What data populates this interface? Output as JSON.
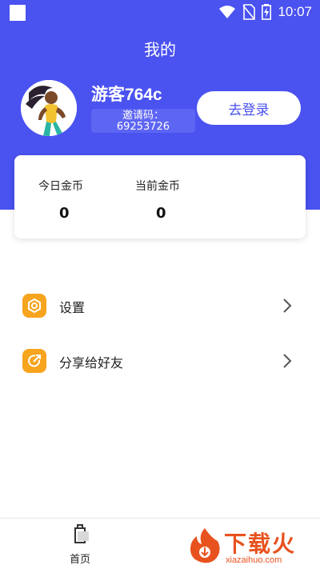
{
  "status_bar": {
    "time": "10:07"
  },
  "header": {
    "title": "我的"
  },
  "profile": {
    "username": "游客764c",
    "invite_label": "邀请码：",
    "invite_code": "69253726",
    "login_button": "去登录"
  },
  "coins": {
    "today_label": "今日金币",
    "today_value": "0",
    "current_label": "当前金币",
    "current_value": "0"
  },
  "menu": {
    "items": [
      {
        "label": "设置",
        "icon": "settings-hexagon-icon"
      },
      {
        "label": "分享给好友",
        "icon": "share-icon"
      }
    ]
  },
  "bottom_nav": {
    "home_label": "首页"
  },
  "watermark": {
    "text": "下载火",
    "url": "xiazaihuo.com"
  },
  "colors": {
    "primary": "#4a52f0",
    "accent": "#f7a41e",
    "watermark": "#e8521e"
  }
}
